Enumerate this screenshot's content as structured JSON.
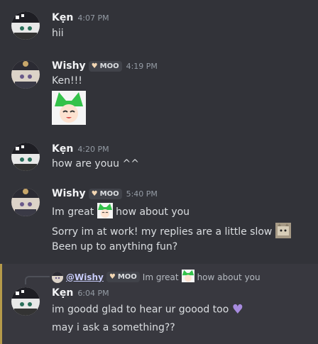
{
  "messages": [
    {
      "name": "Kẹn",
      "time": "4:07 PM",
      "lines": [
        "hii"
      ]
    },
    {
      "name": "Wishy",
      "tag": "MOO",
      "time": "4:19 PM",
      "lines": [
        "Ken!!!"
      ]
    },
    {
      "name": "Kẹn",
      "time": "4:20 PM",
      "lines": [
        "how are youu ^^"
      ]
    },
    {
      "name": "Wishy",
      "tag": "MOO",
      "time": "5:40 PM",
      "lines": [
        "Im great",
        "how about you",
        "Sorry im at work! my replies are a little slow",
        "Been up to anything fun?"
      ]
    },
    {
      "name": "Kẹn",
      "time": "6:04 PM",
      "lines": [
        "im goodd glad to hear ur goood too",
        "may i ask a something??"
      ]
    }
  ],
  "reply": {
    "mention": "@Wishy",
    "tag": "MOO",
    "text1": "Im great",
    "text2": "how about you"
  }
}
